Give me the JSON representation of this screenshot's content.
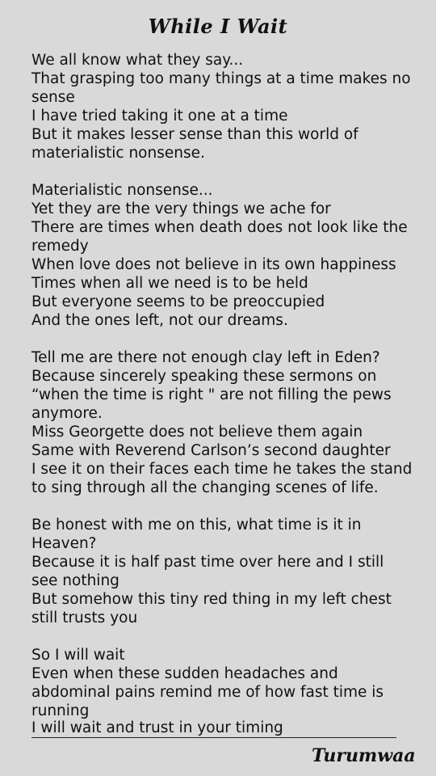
{
  "title": "While I Wait",
  "stanzas": [
    [
      "We all know what they say...",
      "That grasping too many things at a time makes no",
      "sense",
      "I have tried taking it one at a time",
      "But it makes lesser sense than this world of",
      "materialistic nonsense."
    ],
    [
      "Materialistic nonsense...",
      "Yet they are the very things we ache for",
      "There are times when death does not look like the",
      "remedy",
      "When love does not believe in its own happiness",
      "Times when all we need is to be held",
      "But everyone seems to be preoccupied",
      "And the ones left, not our dreams."
    ],
    [
      "Tell me are there not enough clay left in Eden?",
      "Because sincerely speaking these sermons on",
      "“when the time is right \" are not filling the pews",
      "anymore.",
      "Miss Georgette does not believe them again",
      "Same with Reverend Carlson’s second daughter",
      "I see it on their faces each time he takes the stand",
      "to sing through all the changing scenes of life."
    ],
    [
      "Be honest with me on this, what time is it in",
      "Heaven?",
      "Because it is half past time over here and I still",
      "see nothing",
      "But somehow this tiny red thing in my left chest",
      "still trusts you"
    ],
    [
      "So I will wait",
      "Even when these sudden headaches and",
      "abdominal pains remind me of how fast time is",
      "running",
      "I will wait and trust in your timing"
    ]
  ],
  "signature": "Turumwaa"
}
